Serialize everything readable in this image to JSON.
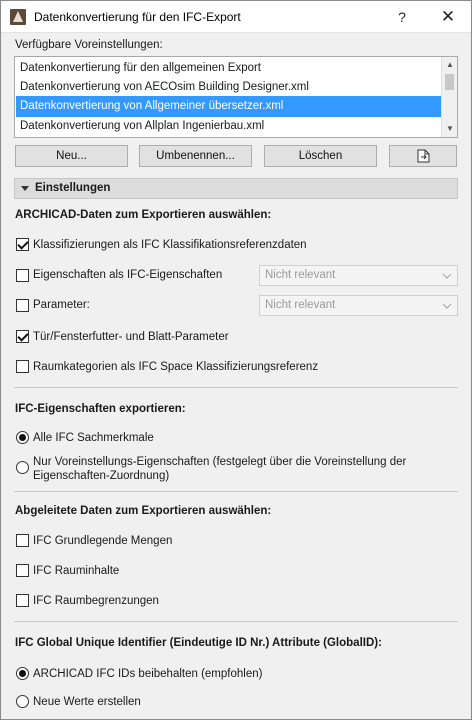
{
  "window": {
    "title": "Datenkonvertierung für den IFC-Export",
    "help_label": "?",
    "close_label": "✕"
  },
  "presets": {
    "label": "Verfügbare Voreinstellungen:",
    "items": [
      "Datenkonvertierung für den allgemeinen Export",
      "Datenkonvertierung von AECOsim Building Designer.xml",
      "Datenkonvertierung von Allgemeiner übersetzer.xml",
      "Datenkonvertierung von Allplan Ingenierbau.xml"
    ],
    "selected_index": 2
  },
  "buttons": {
    "new": "Neu...",
    "rename": "Umbenennen...",
    "delete": "Löschen",
    "export_icon": "document-export-icon"
  },
  "settings": {
    "header": "Einstellungen",
    "archicad_group": {
      "title": "ARCHICAD-Daten zum Exportieren auswählen:",
      "classifications": "Klassifizierungen als IFC Klassifikationsreferenzdaten",
      "properties": "Eigenschaften als IFC-Eigenschaften",
      "properties_select": "Nicht relevant",
      "parameters": "Parameter:",
      "parameters_select": "Nicht relevant",
      "door_window": "Tür/Fensterfutter- und Blatt-Parameter",
      "space_categories": "Raumkategorien als IFC Space Klassifizierungsreferenz"
    },
    "ifc_props_group": {
      "title": "IFC-Eigenschaften exportieren:",
      "all": "Alle IFC Sachmerkmale",
      "only_preset_line1": "Nur Voreinstellungs-Eigenschaften (festgelegt über die Voreinstellung der",
      "only_preset_line2": "Eigenschaften-Zuordnung)"
    },
    "derived_group": {
      "title": "Abgeleitete Daten zum Exportieren auswählen:",
      "base_quantities": "IFC Grundlegende Mengen",
      "space_volumes": "IFC Rauminhalte",
      "space_boundaries": "IFC Raumbegrenzungen"
    },
    "guid_group": {
      "title": "IFC Global Unique Identifier (Eindeutige ID Nr.) Attribute (GlobalID):",
      "keep": "ARCHICAD IFC IDs beibehalten (empfohlen)",
      "new": "Neue Werte erstellen"
    }
  },
  "colors": {
    "selection": "#3399ff",
    "dialog_bg": "#f0f0f0"
  }
}
